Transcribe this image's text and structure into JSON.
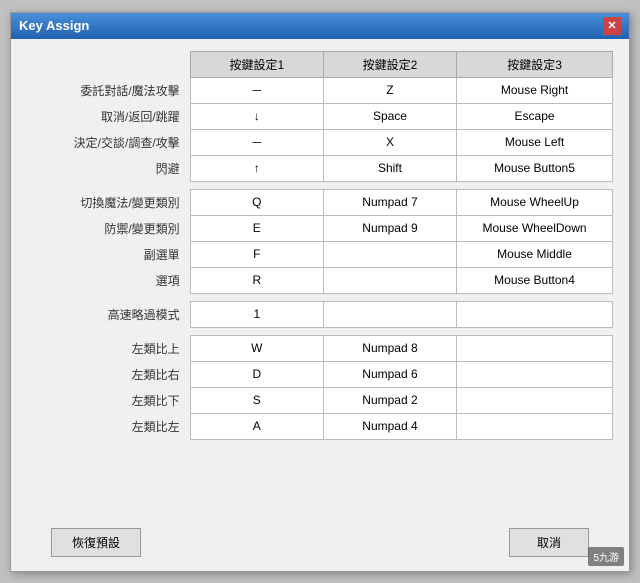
{
  "window": {
    "title": "Key Assign",
    "close_label": "✕"
  },
  "table": {
    "headers": {
      "label_col": "",
      "col1": "按鍵設定1",
      "col2": "按鍵設定2",
      "col3": "按鍵設定3"
    },
    "groups": [
      {
        "rows": [
          {
            "label": "委託對話/魔法攻擊",
            "k1": "－",
            "k2": "Z",
            "k3": "Mouse Right"
          },
          {
            "label": "取消/返回/跳躍",
            "k1": "↓",
            "k2": "Space",
            "k3": "Escape"
          },
          {
            "label": "決定/交談/調查/攻擊",
            "k1": "－",
            "k2": "X",
            "k3": "Mouse Left"
          },
          {
            "label": "閃避",
            "k1": "↑",
            "k2": "Shift",
            "k3": "Mouse Button5"
          }
        ]
      },
      {
        "rows": [
          {
            "label": "切換魔法/變更類別",
            "k1": "Q",
            "k2": "Numpad 7",
            "k3": "Mouse WheelUp"
          },
          {
            "label": "防禦/變更類別",
            "k1": "E",
            "k2": "Numpad 9",
            "k3": "Mouse WheelDown"
          },
          {
            "label": "副選單",
            "k1": "F",
            "k2": "",
            "k3": "Mouse Middle"
          },
          {
            "label": "選項",
            "k1": "R",
            "k2": "",
            "k3": "Mouse Button4"
          }
        ]
      },
      {
        "rows": [
          {
            "label": "高速略過模式",
            "k1": "1",
            "k2": "",
            "k3": ""
          }
        ]
      },
      {
        "rows": [
          {
            "label": "左類比上",
            "k1": "W",
            "k2": "Numpad 8",
            "k3": ""
          },
          {
            "label": "左類比右",
            "k1": "D",
            "k2": "Numpad 6",
            "k3": ""
          },
          {
            "label": "左類比下",
            "k1": "S",
            "k2": "Numpad 2",
            "k3": ""
          },
          {
            "label": "左類比左",
            "k1": "A",
            "k2": "Numpad 4",
            "k3": ""
          }
        ]
      }
    ]
  },
  "footer": {
    "restore_label": "恢復預設",
    "cancel_label": "取消"
  },
  "watermark": "5九游"
}
